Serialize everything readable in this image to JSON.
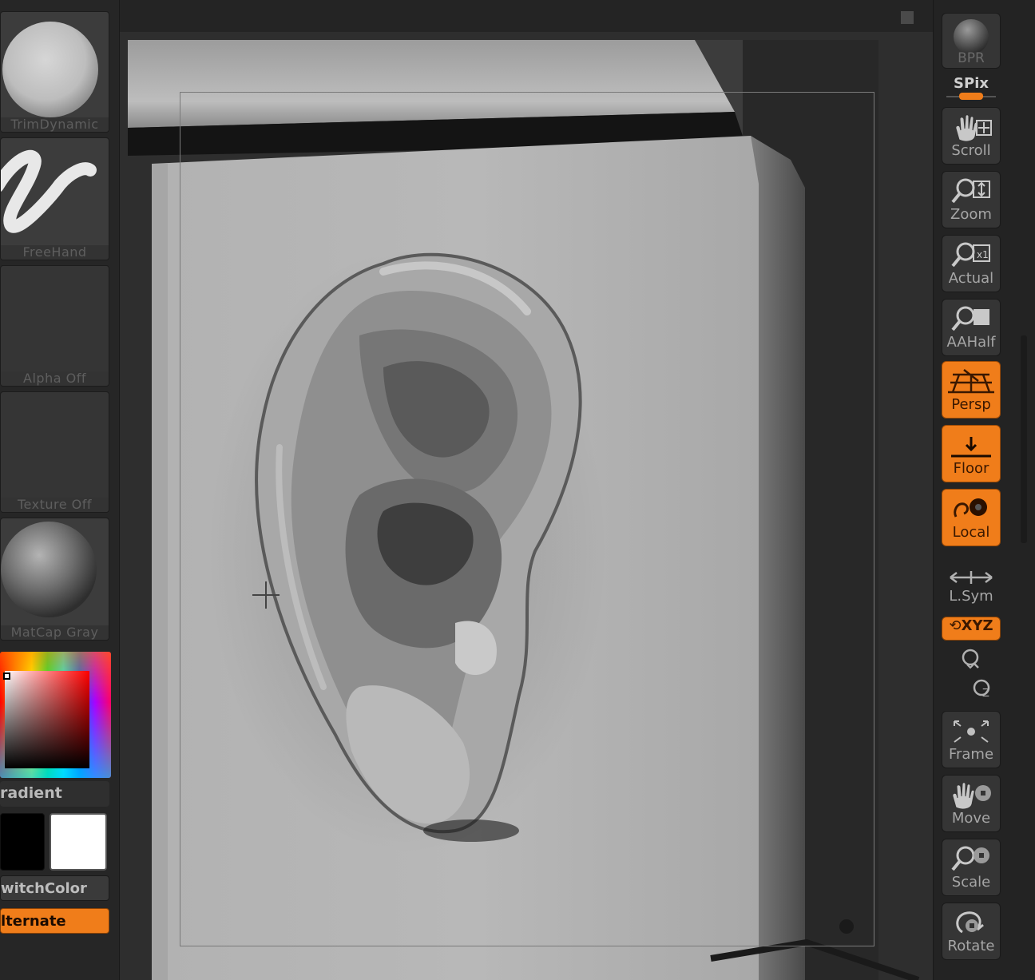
{
  "left_palette": {
    "brush_label": "TrimDynamic",
    "stroke_label": "FreeHand",
    "alpha_label": "Alpha  Off",
    "texture_label": "Texture  Off",
    "material_label": "MatCap  Gray",
    "gradient_label": "radient",
    "switchcolor_label": "witchColor",
    "alternate_label": "lternate",
    "colors": {
      "main": "#000000",
      "secondary": "#ffffff",
      "accent": "#f07d1a"
    }
  },
  "right_shelf": {
    "bpr_label": "BPR",
    "spix_label": "SPix",
    "scroll_label": "Scroll",
    "zoom_label": "Zoom",
    "actual_label": "Actual",
    "aahalf_label": "AAHalf",
    "persp_label": "Persp",
    "floor_label": "Floor",
    "local_label": "Local",
    "lsym_label": "L.Sym",
    "xyz_label": "XYZ",
    "frame_label": "Frame",
    "move_label": "Move",
    "scale_label": "Scale",
    "rotate_label": "Rotate",
    "active_buttons": [
      "Persp",
      "Floor",
      "Local",
      "XYZ"
    ]
  },
  "icons": [
    "hand-icon",
    "magnifier-icon",
    "sphere-icon",
    "floor-grid-icon",
    "rotate-icon",
    "scale-icon"
  ]
}
